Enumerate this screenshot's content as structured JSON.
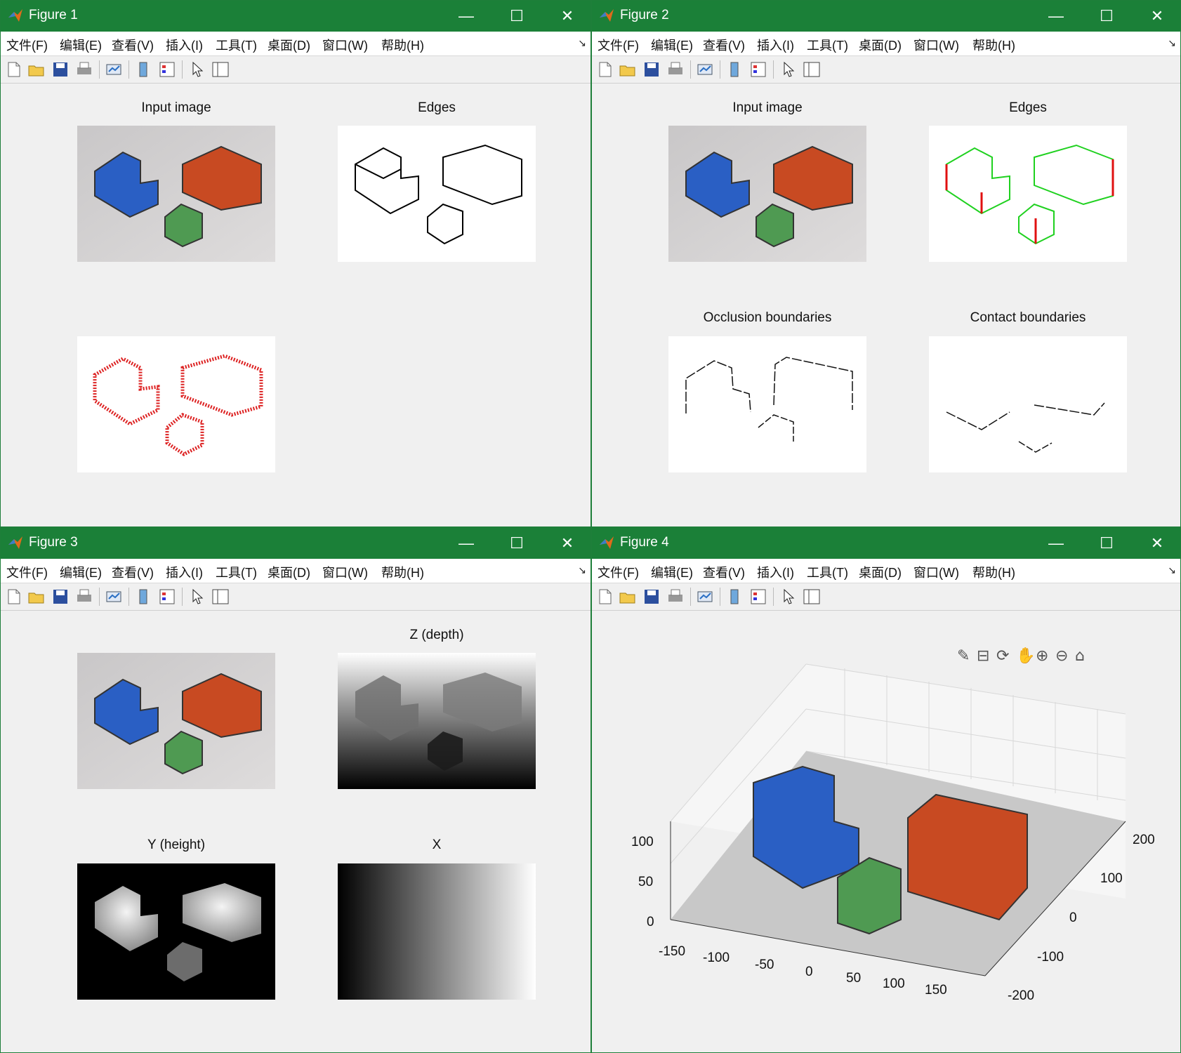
{
  "menu": [
    "文件(F)",
    "编辑(E)",
    "查看(V)",
    "插入(I)",
    "工具(T)",
    "桌面(D)",
    "窗口(W)",
    "帮助(H)"
  ],
  "figures": [
    {
      "title": "Figure 1",
      "axes": [
        {
          "title": "Input image"
        },
        {
          "title": "Edges"
        },
        {
          "title": ""
        }
      ]
    },
    {
      "title": "Figure 2",
      "axes": [
        {
          "title": "Input image"
        },
        {
          "title": "Edges"
        },
        {
          "title": "Occlusion boundaries"
        },
        {
          "title": "Contact boundaries"
        }
      ]
    },
    {
      "title": "Figure 3",
      "axes": [
        {
          "title": ""
        },
        {
          "title": "Z (depth)"
        },
        {
          "title": "Y (height)"
        },
        {
          "title": "X"
        }
      ]
    },
    {
      "title": "Figure 4",
      "ticks": {
        "z": [
          "100",
          "50",
          "0"
        ],
        "x": [
          "-150",
          "-100",
          "-50",
          "0",
          "50",
          "100",
          "150"
        ],
        "y": [
          "200",
          "100",
          "0",
          "-100",
          "-200"
        ]
      }
    }
  ],
  "colors": {
    "titlebar": "#1b8038",
    "blue_block": "#2a5fc4",
    "red_block": "#c84a22",
    "green_block": "#4f9a52"
  },
  "icons": [
    "new-figure-icon",
    "open-file-icon",
    "save-icon",
    "print-icon",
    "link-plot-icon",
    "colorbar-icon",
    "legend-icon",
    "edit-plot-icon",
    "property-inspector-icon"
  ],
  "axes_toolbar_icons": [
    "brush-icon",
    "data-tips-icon",
    "rotate-icon",
    "pan-icon",
    "zoom-in-icon",
    "zoom-out-icon",
    "home-icon"
  ]
}
